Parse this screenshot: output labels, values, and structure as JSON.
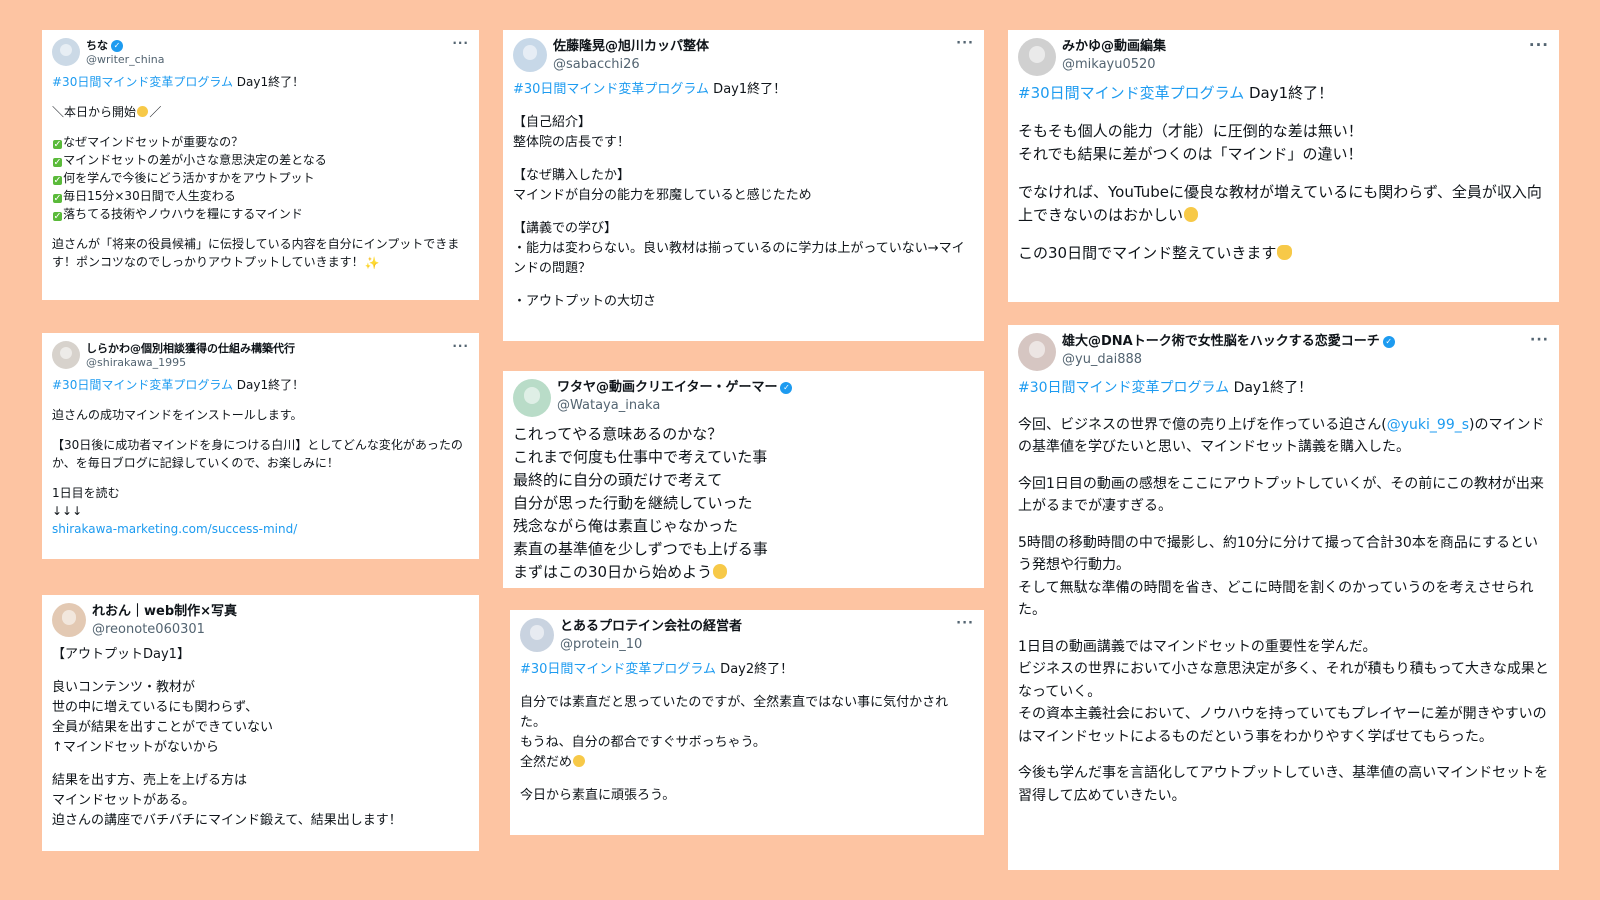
{
  "colors": {
    "background": "#fdc4a2",
    "link": "#1d9bf0",
    "verified": "#1d9bf0"
  },
  "tweets": [
    {
      "name": "ちな",
      "handle": "@writer_china",
      "verified": true,
      "more": "···",
      "p": [
        [
          {
            "t": "#30日間マインド変革プログラム",
            "c": "tag"
          },
          {
            "t": " Day1終了！"
          }
        ],
        [],
        [
          {
            "t": "＼本日から開始"
          },
          {
            "e": "face"
          },
          {
            "t": "／"
          }
        ],
        [],
        [
          {
            "e": "check"
          },
          {
            "t": "なぜマインドセットが重要なの？"
          }
        ],
        [
          {
            "e": "check"
          },
          {
            "t": "マインドセットの差が小さな意思決定の差となる"
          }
        ],
        [
          {
            "e": "check"
          },
          {
            "t": "何を学んで今後にどう活かすかをアウトプット"
          }
        ],
        [
          {
            "e": "check"
          },
          {
            "t": "毎日15分×30日間で人生変わる"
          }
        ],
        [
          {
            "e": "check"
          },
          {
            "t": "落ちてる技術やノウハウを糧にするマインド"
          }
        ],
        [],
        [
          {
            "t": "迫さんが「将来の役員候補」に伝授している内容を自分にインプットできます！ポンコツなのでしっかりアウトプットしていきます！"
          },
          {
            "e": "spark"
          }
        ]
      ]
    },
    {
      "name": "しらかわ@個別相談獲得の仕組み構築代行",
      "handle": "@shirakawa_1995",
      "verified": false,
      "more": "···",
      "p": [
        [
          {
            "t": "#30日間マインド変革プログラム",
            "c": "tag"
          },
          {
            "t": " Day1終了！"
          }
        ],
        [],
        [
          {
            "t": "迫さんの成功マインドをインストールします。"
          }
        ],
        [],
        [
          {
            "t": "【30日後に成功者マインドを身につける白川】としてどんな変化があったのか、を毎日ブログに記録していくので、お楽しみに！"
          }
        ],
        [],
        [
          {
            "t": "1日目を読む"
          }
        ],
        [
          {
            "t": "↓↓↓"
          }
        ],
        [
          {
            "t": "shirakawa-marketing.com/success-mind/",
            "c": "link"
          }
        ]
      ]
    },
    {
      "name": "れおん｜web制作×写真",
      "handle": "@reonote060301",
      "verified": false,
      "more": "",
      "p": [
        [
          {
            "t": "【アウトプットDay1】"
          }
        ],
        [],
        [
          {
            "t": "良いコンテンツ・教材が"
          }
        ],
        [
          {
            "t": "世の中に増えているにも関わらず、"
          }
        ],
        [
          {
            "t": "全員が結果を出すことができていない"
          }
        ],
        [
          {
            "t": "↑マインドセットがないから"
          }
        ],
        [],
        [
          {
            "t": "結果を出す方、売上を上げる方は"
          }
        ],
        [
          {
            "t": "マインドセットがある。"
          }
        ],
        [
          {
            "t": "迫さんの講座でバチバチにマインド鍛えて、結果出します！"
          }
        ]
      ]
    },
    {
      "name": "佐藤隆晃@旭川カッパ整体",
      "handle": "@sabacchi26",
      "verified": false,
      "more": "···",
      "p": [
        [
          {
            "t": "#30日間マインド変革プログラム",
            "c": "tag"
          },
          {
            "t": " Day1終了！"
          }
        ],
        [],
        [
          {
            "t": "【自己紹介】"
          }
        ],
        [
          {
            "t": "整体院の店長です！"
          }
        ],
        [],
        [
          {
            "t": "【なぜ購入したか】"
          }
        ],
        [
          {
            "t": "マインドが自分の能力を邪魔していると感じたため"
          }
        ],
        [],
        [
          {
            "t": "【講義での学び】"
          }
        ],
        [
          {
            "t": "・能力は変わらない。良い教材は揃っているのに学力は上がっていない→マインドの問題？"
          }
        ],
        [],
        [
          {
            "t": "・アウトプットの大切さ"
          }
        ]
      ]
    },
    {
      "name": "ワタヤ@動画クリエイター・ゲーマー",
      "handle": "@Wataya_inaka",
      "verified": true,
      "more": "",
      "p": [
        [
          {
            "t": "これってやる意味あるのかな？"
          }
        ],
        [
          {
            "t": "これまで何度も仕事中で考えていた事"
          }
        ],
        [
          {
            "t": "最終的に自分の頭だけで考えて"
          }
        ],
        [
          {
            "t": "自分が思った行動を継続していった"
          }
        ],
        [
          {
            "t": "残念ながら俺は素直じゃなかった"
          }
        ],
        [
          {
            "t": "素直の基準値を少しずつでも上げる事"
          }
        ],
        [
          {
            "t": "まずはこの30日から始めよう"
          },
          {
            "e": "face"
          }
        ]
      ]
    },
    {
      "name": "とあるプロテイン会社の経営者",
      "handle": "@protein_10",
      "verified": false,
      "more": "···",
      "p": [
        [
          {
            "t": "#30日間マインド変革プログラム",
            "c": "tag"
          },
          {
            "t": " Day2終了！"
          }
        ],
        [],
        [
          {
            "t": "自分では素直だと思っていたのですが、全然素直ではない事に気付かされた。"
          }
        ],
        [
          {
            "t": "もうね、自分の都合ですぐサボっちゃう。"
          }
        ],
        [
          {
            "t": "全然だめ"
          },
          {
            "e": "face"
          }
        ],
        [],
        [
          {
            "t": "今日から素直に頑張ろう。"
          }
        ]
      ]
    },
    {
      "name": "みかゆ@動画編集",
      "handle": "@mikayu0520",
      "verified": false,
      "more": "···",
      "p": [
        [
          {
            "t": "#30日間マインド変革プログラム",
            "c": "tag"
          },
          {
            "t": " Day1終了！"
          }
        ],
        [],
        [
          {
            "t": "そもそも個人の能力（才能）に圧倒的な差は無い！"
          }
        ],
        [
          {
            "t": "それでも結果に差がつくのは「マインド」の違い！"
          }
        ],
        [],
        [
          {
            "t": "でなければ、YouTubeに優良な教材が増えているにも関わらず、全員が収入向上できないのはおかしい"
          },
          {
            "e": "face"
          }
        ],
        [],
        [
          {
            "t": "この30日間でマインド整えていきます"
          },
          {
            "e": "arm"
          }
        ]
      ]
    },
    {
      "name": "雄大@DNAトーク術で女性脳をハックする恋愛コーチ",
      "handle": "@yu_dai888",
      "verified": true,
      "more": "···",
      "p": [
        [
          {
            "t": "#30日間マインド変革プログラム",
            "c": "tag"
          },
          {
            "t": " Day1終了！"
          }
        ],
        [],
        [
          {
            "t": "今回、ビジネスの世界で億の売り上げを作っている迫さん("
          },
          {
            "t": "@yuki_99_s",
            "c": "link"
          },
          {
            "t": ")のマインドの基準値を学びたいと思い、マインドセット講義を購入した。"
          }
        ],
        [],
        [
          {
            "t": "今回1日目の動画の感想をここにアウトプットしていくが、その前にこの教材が出来上がるまでが凄すぎる。"
          }
        ],
        [],
        [
          {
            "t": "5時間の移動時間の中で撮影し、約10分に分けて撮って合計30本を商品にするという発想や行動力。"
          }
        ],
        [
          {
            "t": "そして無駄な準備の時間を省き、どこに時間を割くのかっていうのを考えさせられた。"
          }
        ],
        [],
        [
          {
            "t": "1日目の動画講義ではマインドセットの重要性を学んだ。"
          }
        ],
        [
          {
            "t": "ビジネスの世界において小さな意思決定が多く、それが積もり積もって大きな成果となっていく。"
          }
        ],
        [
          {
            "t": "その資本主義社会において、ノウハウを持っていてもプレイヤーに差が開きやすいのはマインドセットによるものだという事をわかりやすく学ばせてもらった。"
          }
        ],
        [],
        [
          {
            "t": "今後も学んだ事を言語化してアウトプットしていき、基準値の高いマインドセットを習得して広めていきたい。"
          }
        ]
      ]
    }
  ]
}
